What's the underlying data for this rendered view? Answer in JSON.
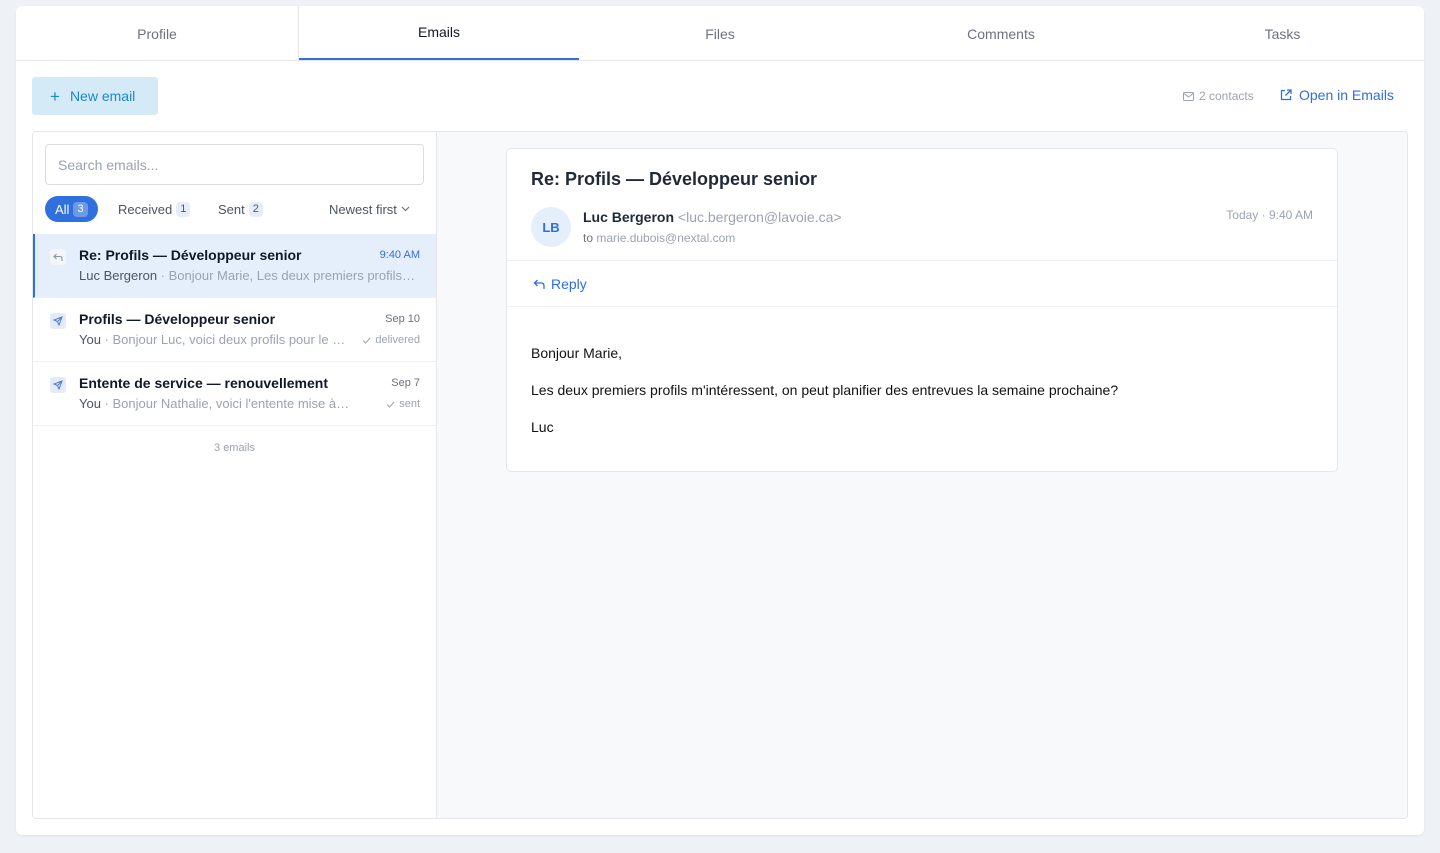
{
  "tabs": [
    "Profile",
    "Emails",
    "Files",
    "Comments",
    "Tasks"
  ],
  "active_tab": "Emails",
  "toolbar": {
    "new_email": "New email",
    "contacts": "2 contacts",
    "open_in_emails": "Open in Emails"
  },
  "search": {
    "placeholder": "Search emails..."
  },
  "filters": {
    "all": "All",
    "all_count": "3",
    "received": "Received",
    "received_count": "1",
    "sent": "Sent",
    "sent_count": "2",
    "sort": "Newest first"
  },
  "emails": [
    {
      "subject": "Re: Profils — Développeur senior",
      "date": "9:40 AM",
      "who": "Luc Bergeron",
      "snippet": "Bonjour Marie, Les deux premiers profils m'intéressent",
      "status": "",
      "direction": "received"
    },
    {
      "subject": "Profils — Développeur senior",
      "date": "Sep 10",
      "who": "You",
      "snippet": "Bonjour Luc, voici deux profils pour le poste",
      "status": "delivered",
      "direction": "sent"
    },
    {
      "subject": "Entente de service — renouvellement",
      "date": "Sep 7",
      "who": "You",
      "snippet": "Bonjour Nathalie, voici l'entente mise à jour",
      "status": "sent",
      "direction": "sent"
    }
  ],
  "list_footer": "3 emails",
  "reader": {
    "subject": "Re: Profils — Développeur senior",
    "avatar_initials": "LB",
    "from_name": "Luc Bergeron",
    "from_email": "<luc.bergeron@lavoie.ca>",
    "to_label": "to",
    "to_address": "marie.dubois@nextal.com",
    "timestamp": "Today · 9:40 AM",
    "reply_label": "Reply",
    "body": [
      "Bonjour Marie,",
      "Les deux premiers profils m'intéressent, on peut planifier des entrevues la semaine prochaine?",
      "Luc"
    ]
  },
  "colors": {
    "accent": "#2f6fde",
    "new_email_bg": "#d4ebf7",
    "new_email_text": "#1c87c9",
    "selected_row": "#e5eefb"
  }
}
